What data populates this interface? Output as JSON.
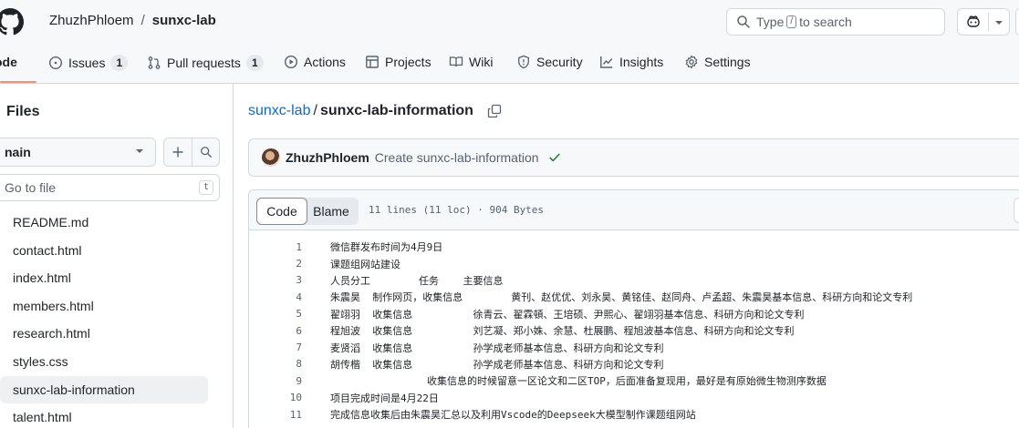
{
  "header": {
    "owner": "ZhuzhPhloem",
    "separator": "/",
    "repo": "sunxc-lab",
    "search_prefix": "Type",
    "search_key": "/",
    "search_suffix": "to search"
  },
  "tabs": [
    {
      "label": "ode",
      "icon": "code-icon"
    },
    {
      "label": "Issues",
      "icon": "issue-icon",
      "count": "1"
    },
    {
      "label": "Pull requests",
      "icon": "pull-request-icon",
      "count": "1"
    },
    {
      "label": "Actions",
      "icon": "play-icon"
    },
    {
      "label": "Projects",
      "icon": "table-icon"
    },
    {
      "label": "Wiki",
      "icon": "book-icon"
    },
    {
      "label": "Security",
      "icon": "shield-icon"
    },
    {
      "label": "Insights",
      "icon": "graph-icon"
    },
    {
      "label": "Settings",
      "icon": "gear-icon"
    }
  ],
  "sidebar": {
    "title": "Files",
    "branch": "nain",
    "goto_placeholder": "Go to file",
    "goto_key": "t",
    "files": [
      "README.md",
      "contact.html",
      "index.html",
      "members.html",
      "research.html",
      "styles.css",
      "sunxc-lab-information",
      "talent.html"
    ],
    "selected_file": "sunxc-lab-information"
  },
  "breadcrumb": {
    "repo": "sunxc-lab",
    "separator": "/",
    "file": "sunxc-lab-information"
  },
  "commit": {
    "author": "ZhuzhPhloem",
    "message": "Create sunxc-lab-information"
  },
  "code_view": {
    "code_tab": "Code",
    "blame_tab": "Blame",
    "meta": "11 lines (11 loc) · 904 Bytes",
    "lines": [
      {
        "n": "1",
        "text": "微信群发布时间为4月9日"
      },
      {
        "n": "2",
        "text": "课题组网站建设"
      },
      {
        "n": "3",
        "text": "人员分工        任务    主要信息"
      },
      {
        "n": "4",
        "text": "朱震昊  制作网页，收集信息        黄刊、赵优优、刘永昊、黄铭佳、赵同舟、卢孟超、朱震昊基本信息、科研方向和论文专利"
      },
      {
        "n": "5",
        "text": "翟翊羽  收集信息          徐青云、翟霖頓、王培硕、尹熙心、翟翊羽基本信息、科研方向和论文专利"
      },
      {
        "n": "6",
        "text": "程旭波  收集信息          刘艺凝、郑小姝、余慧、杜展鹏、程旭波基本信息、科研方向和论文专利"
      },
      {
        "n": "7",
        "text": "麦贤滔  收集信息          孙学成老师基本信息、科研方向和论文专利"
      },
      {
        "n": "8",
        "text": "胡传楷  收集信息          孙学成老师基本信息、科研方向和论文专利"
      },
      {
        "n": "9",
        "text": "                收集信息的时候留意一区论文和二区TOP，后面准备复现用，最好是有原始微生物测序数据"
      },
      {
        "n": "10",
        "text": "项目完成时间是4月22日"
      },
      {
        "n": "11",
        "text": "完成信息收集后由朱震昊汇总以及利用Vscode的Deepseek大模型制作课题组网站"
      }
    ]
  },
  "colors": {
    "link": "#0969da",
    "active_tab_underline": "#fd8c73",
    "success": "#1a7f37",
    "header_bg": "#f6f8fa"
  }
}
